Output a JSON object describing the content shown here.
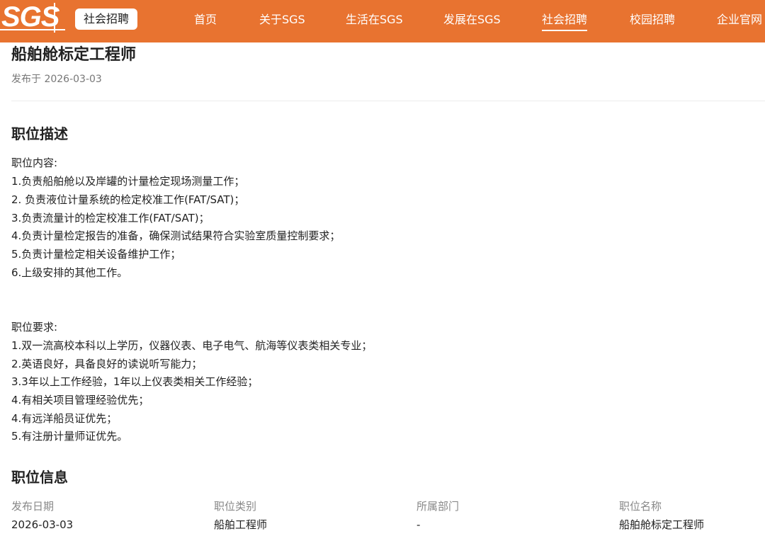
{
  "header": {
    "logo_text": "SGS",
    "badge_label": "社会招聘",
    "nav": [
      {
        "label": "首页"
      },
      {
        "label": "关于SGS"
      },
      {
        "label": "生活在SGS"
      },
      {
        "label": "发展在SGS"
      },
      {
        "label": "社会招聘"
      },
      {
        "label": "校园招聘"
      },
      {
        "label": "企业官网"
      }
    ],
    "active_nav": "社会招聘",
    "color": "#e87330"
  },
  "job": {
    "title": "船舶舱标定工程师",
    "published": "发布于 2026-03-03"
  },
  "description": {
    "heading": "职位描述",
    "content_title": "职位内容:",
    "content": [
      "1.负责船舶舱以及岸罐的计量检定现场测量工作；",
      "2. 负责液位计量系统的检定校准工作(FAT/SAT)；",
      "3.负责流量计的检定校准工作(FAT/SAT)；",
      "4.负责计量检定报告的准备，确保测试结果符合实验室质量控制要求；",
      "5.负责计量检定相关设备维护工作；",
      "6.上级安排的其他工作。"
    ],
    "requirements_title": "职位要求:",
    "requirements": [
      "1.双一流高校本科以上学历，仪器仪表、电子电气、航海等仪表类相关专业；",
      "2.英语良好，具备良好的读说听写能力；",
      "3.3年以上工作经验，1年以上仪表类相关工作经验；",
      "4.有相关项目管理经验优先；",
      "4.有远洋船员证优先；",
      "5.有注册计量师证优先。"
    ]
  },
  "info": {
    "heading": "职位信息",
    "fields": [
      {
        "label": "发布日期",
        "value": "2026-03-03"
      },
      {
        "label": "职位类别",
        "value": "船舶工程师"
      },
      {
        "label": "所属部门",
        "value": "-"
      },
      {
        "label": "职位名称",
        "value": "船舶舱标定工程师"
      }
    ]
  }
}
